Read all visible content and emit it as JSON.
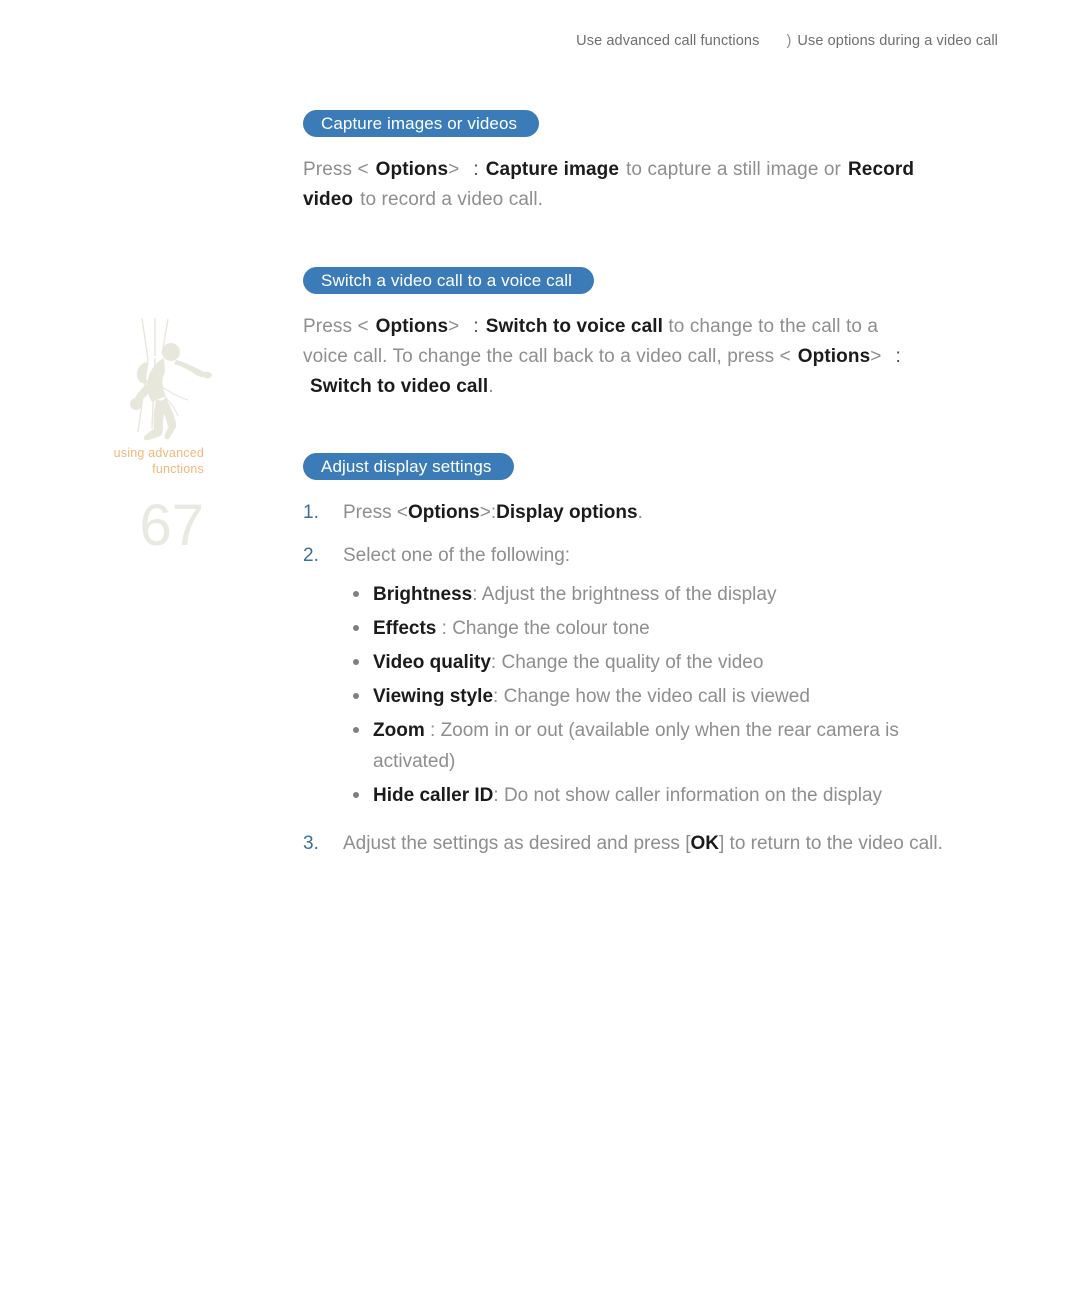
{
  "header": {
    "left": "Use advanced call functions",
    "separator": ")",
    "right": "Use options during a video call"
  },
  "margin": {
    "watermark_icon": "climber-silhouette-icon",
    "caption_line1": "using advanced",
    "caption_line2": "functions",
    "page_number": "67",
    "caption_color": "#f4b77a",
    "page_number_color": "#e9e9e1",
    "watermark_color": "#e8e7dc"
  },
  "theme": {
    "pill_blue": "#3b7cb8",
    "step_number_blue": "#3d6f95",
    "body_gray": "#8e8e8e",
    "bold_black": "#1b1b1b"
  },
  "sections": [
    {
      "heading": "Capture images or videos",
      "body": {
        "t1": "Press <",
        "b1": "Options",
        "t2": ">",
        "c1": ":",
        "b2": "Capture image",
        "t3": "to capture a still image or",
        "b3": "Record video",
        "t4": "to record a video call."
      }
    },
    {
      "heading": "Switch a video call to a voice call",
      "body": {
        "t1": "Press <",
        "b1": "Options",
        "t2": ">",
        "c1": ":",
        "b2": "Switch to voice call",
        "t3": "to change to the call to a voice call. To change the call back to a video call, press <",
        "b3": "Options",
        "t4": ">",
        "c2": ":",
        "b4": "Switch to video call",
        "t5": "."
      }
    },
    {
      "heading": "Adjust display settings"
    }
  ],
  "steps": [
    {
      "num": "1.",
      "t1": "Press <",
      "b1": "Options",
      "t2": ">",
      "c1": ":",
      "b2": "Display options",
      "t3": "."
    },
    {
      "num": "2.",
      "t1": "Select one of the following:"
    },
    {
      "num": "3.",
      "t1": "Adjust the settings as desired and press [",
      "b1": "OK",
      "t2": "] to return to the video call."
    }
  ],
  "options": [
    {
      "term": "Brightness",
      "sep": ":",
      "desc": "Adjust the brightness of the display"
    },
    {
      "term": "Effects",
      "sep": ":",
      "desc": "Change the colour tone"
    },
    {
      "term": "Video quality",
      "sep": ":",
      "desc": "Change the quality of the video"
    },
    {
      "term": "Viewing style",
      "sep": ":",
      "desc": "Change how the video call is viewed"
    },
    {
      "term": "Zoom",
      "sep": ":",
      "desc": "Zoom in or out (available only when the rear camera is activated)"
    },
    {
      "term": "Hide caller ID",
      "sep": ":",
      "desc": "Do not show caller information on the display"
    }
  ]
}
